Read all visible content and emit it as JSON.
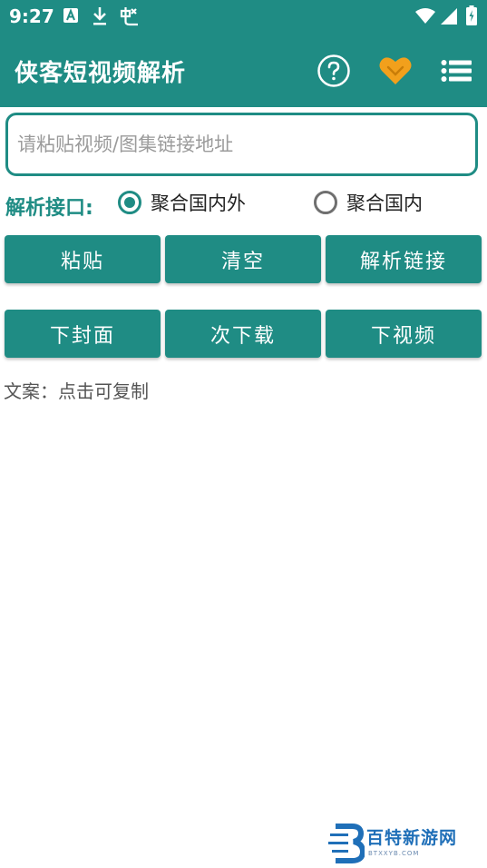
{
  "status_bar": {
    "time": "9:27"
  },
  "app": {
    "title": "侠客短视频解析"
  },
  "input": {
    "placeholder": "请粘贴视频/图集链接地址",
    "value": ""
  },
  "api": {
    "label": "解析接口:",
    "options": [
      {
        "label": "聚合国内外",
        "selected": true
      },
      {
        "label": "聚合国内",
        "selected": false
      }
    ]
  },
  "buttons_row1": {
    "paste": "粘贴",
    "clear": "清空",
    "parse": "解析链接"
  },
  "buttons_row2": {
    "cover": "下封面",
    "download": "次下载",
    "video": "下视频"
  },
  "copy_hint": "文案：点击可复制",
  "watermark": {
    "name": "百特新游网",
    "domain": "BTXXYB.COM"
  },
  "colors": {
    "primary": "#1f8c84",
    "heart": "#f2a01c"
  }
}
